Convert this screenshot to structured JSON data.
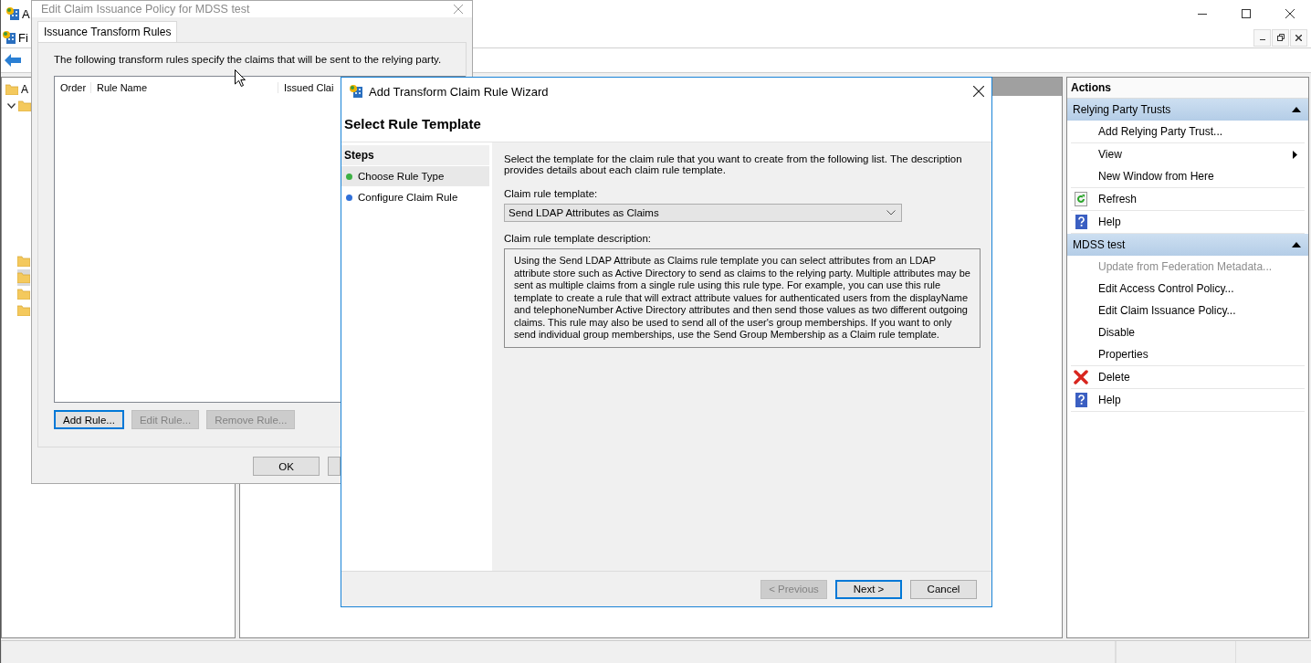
{
  "main_window": {
    "title": "A",
    "menu": [
      {
        "label": "Fi"
      }
    ],
    "tree": [
      {
        "label": "A"
      },
      {
        "expanded": true,
        "children": [
          {
            "selected": false
          },
          {
            "selected": true
          },
          {
            "selected": false
          },
          {
            "selected": false
          }
        ]
      }
    ],
    "actions": {
      "title": "Actions",
      "sections": [
        {
          "title": "Relying Party Trusts",
          "expanded": true,
          "groups": [
            {
              "items": [
                {
                  "label": "Add Relying Party Trust...",
                  "kind": "plain",
                  "disabled": false
                }
              ]
            },
            {
              "items": [
                {
                  "label": "View",
                  "kind": "submenu",
                  "disabled": false
                },
                {
                  "label": "New Window from Here",
                  "kind": "plain",
                  "disabled": false
                }
              ]
            },
            {
              "items": [
                {
                  "label": "Refresh",
                  "kind": "refresh",
                  "disabled": false
                }
              ]
            },
            {
              "items": [
                {
                  "label": "Help",
                  "kind": "help",
                  "disabled": false
                }
              ]
            }
          ]
        },
        {
          "title": "MDSS test",
          "expanded": true,
          "groups": [
            {
              "items": [
                {
                  "label": "Update from Federation Metadata...",
                  "kind": "plain",
                  "disabled": true
                },
                {
                  "label": "Edit Access Control Policy...",
                  "kind": "plain",
                  "disabled": false
                },
                {
                  "label": "Edit Claim Issuance Policy...",
                  "kind": "plain",
                  "disabled": false
                },
                {
                  "label": "Disable",
                  "kind": "plain",
                  "disabled": false
                },
                {
                  "label": "Properties",
                  "kind": "plain",
                  "disabled": false
                }
              ]
            },
            {
              "items": [
                {
                  "label": "Delete",
                  "kind": "delete",
                  "disabled": false
                }
              ]
            },
            {
              "items": [
                {
                  "label": "Help",
                  "kind": "help",
                  "disabled": false
                }
              ]
            }
          ]
        }
      ]
    }
  },
  "policy_dialog": {
    "title": "Edit Claim Issuance Policy for MDSS test",
    "tabs": [
      {
        "label": "Issuance Transform Rules",
        "selected": true
      }
    ],
    "description": "The following transform rules specify the claims that will be sent to the relying party.",
    "columns": [
      "Order",
      "Rule Name",
      "Issued Clai"
    ],
    "buttons": [
      {
        "label": "Add Rule...",
        "disabled": false,
        "default": true
      },
      {
        "label": "Edit Rule...",
        "disabled": true,
        "default": false
      },
      {
        "label": "Remove Rule...",
        "disabled": true,
        "default": false
      }
    ],
    "footer_buttons": [
      {
        "label": "OK",
        "disabled": false,
        "default": false
      }
    ]
  },
  "wizard": {
    "title": "Add Transform Claim Rule Wizard",
    "heading": "Select Rule Template",
    "steps_title": "Steps",
    "steps": [
      {
        "label": "Choose Rule Type",
        "selected": true,
        "color": "#3cb043"
      },
      {
        "label": "Configure Claim Rule",
        "selected": false,
        "color": "#2f6fd8"
      }
    ],
    "intro": "Select the template for the claim rule that you want to create from the following list. The description provides details about each claim rule template.",
    "template_label": "Claim rule template:",
    "template_value": "Send LDAP Attributes as Claims",
    "description_label": "Claim rule template description:",
    "description": "Using the Send LDAP Attribute as Claims rule template you can select attributes from an LDAP attribute store such as Active Directory to send as claims to the relying party. Multiple attributes may be sent as multiple claims from a single rule using this rule type. For example, you can use this rule template to create a rule that will extract attribute values for authenticated users from the displayName and telephoneNumber Active Directory attributes and then send those values as two different outgoing claims. This rule may also be used to send all of the user's group memberships. If you want to only send individual group memberships, use the Send Group Membership as a Claim rule template.",
    "buttons": [
      {
        "label": "< Previous",
        "disabled": true,
        "default": false
      },
      {
        "label": "Next >",
        "disabled": false,
        "default": true
      },
      {
        "label": "Cancel",
        "disabled": false,
        "default": false
      }
    ]
  }
}
